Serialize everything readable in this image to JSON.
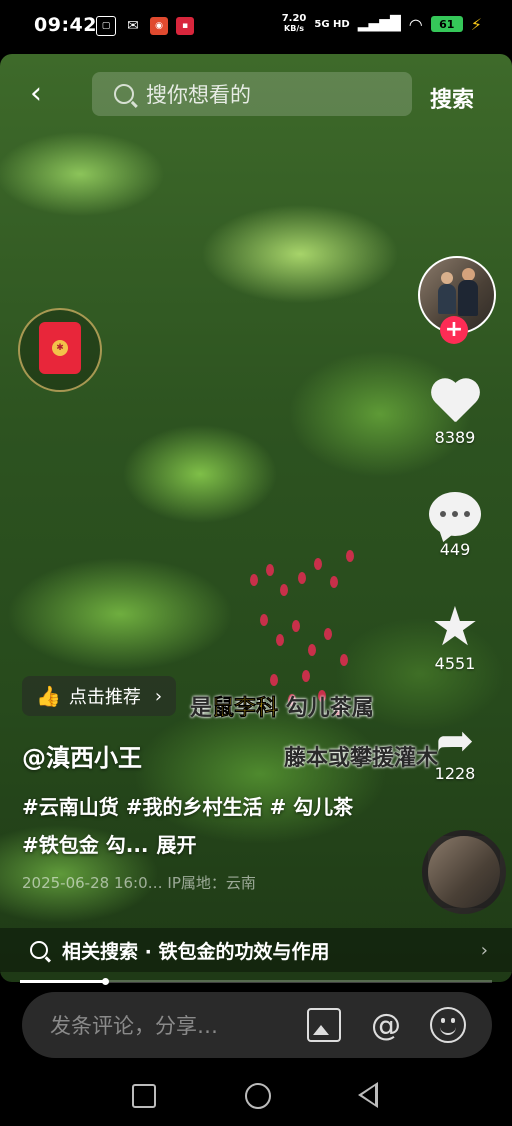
{
  "status_bar": {
    "time": "09:42",
    "net_speed_value": "7.20",
    "net_speed_unit": "KB/s",
    "network": "5G HD",
    "battery": "61",
    "apps": [
      "bilibili-icon",
      "wechat-icon",
      "app-icon",
      "news-app-icon"
    ]
  },
  "top_bar": {
    "search_placeholder": "搜你想看的",
    "search_button": "搜索"
  },
  "side_rail": {
    "likes": "8389",
    "comments": "449",
    "favorites": "4551",
    "shares": "1228"
  },
  "recommend": {
    "label": "点击推荐",
    "chevron": "›"
  },
  "video_overlay": {
    "caption_part1": "是",
    "caption_highlight": "鼠李科",
    "caption_part2": "勾儿茶属",
    "caption_line2": "藤本或攀援灌木"
  },
  "post": {
    "author": "@滇西小王",
    "description": "#云南山货 #我的乡村生活 # 勾儿茶 #铁包金 勾...",
    "expand": "展开",
    "date_location": "2025-06-28 16:0…  IP属地：云南"
  },
  "related_search": {
    "label": "相关搜索 · 铁包金的功效与作用",
    "arrow": "›"
  },
  "progress": {
    "fraction": 0.18
  },
  "comment_bar": {
    "placeholder": "发条评论，分享…"
  },
  "colors": {
    "accent": "#fe2c55",
    "highlight": "#f4c81a",
    "battery": "#35c759"
  }
}
